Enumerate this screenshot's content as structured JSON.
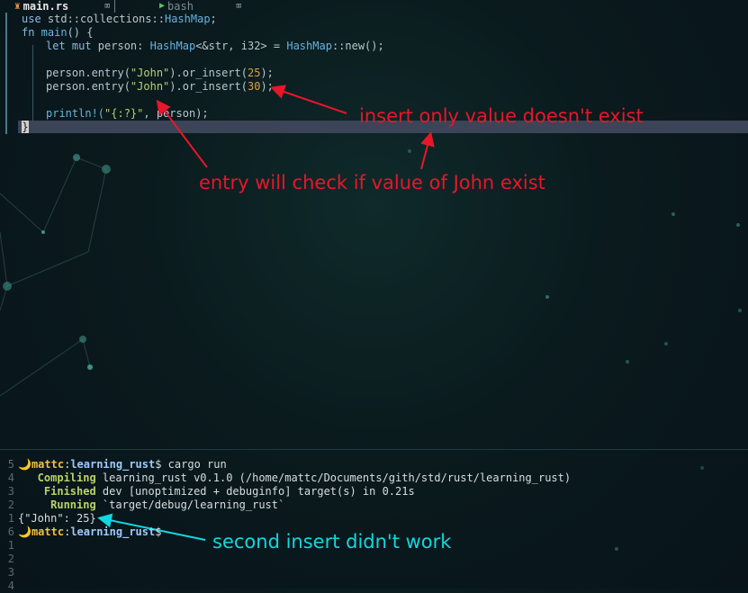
{
  "tabs": {
    "active": {
      "icon": "rust-file-icon",
      "label": "main.rs"
    },
    "second": {
      "icon": "terminal-icon",
      "label": "bash"
    },
    "close_glyph": "⌧"
  },
  "code": {
    "line1": {
      "kw": "use",
      "path": " std::collections::",
      "type": "HashMap",
      "end": ";"
    },
    "line2": {
      "kw": "fn",
      "name": " main",
      "rest": "() {"
    },
    "line3": {
      "kw": "let mut",
      "var": " person: ",
      "type1": "HashMap",
      "gen": "<&str, i32>",
      "eq": " = ",
      "type2": "HashMap",
      "call": "::new();"
    },
    "line4": {
      "pre": "person.entry(",
      "str": "\"John\"",
      "mid": ").or_insert(",
      "num": "25",
      "end": ");"
    },
    "line5": {
      "pre": "person.entry(",
      "str": "\"John\"",
      "mid": ").or_insert(",
      "num": "30",
      "end": ");"
    },
    "line6": {
      "pre": "println!(",
      "str": "\"{:?}\"",
      "end": ", person);"
    },
    "line7": "}"
  },
  "annotations": {
    "insert_note": "insert only value doesn't exist",
    "entry_note": "entry will check if value of John exist",
    "result_note": "second insert didn't work"
  },
  "terminal": {
    "prompt_user": "mattc",
    "prompt_colon": ":",
    "prompt_dir": "learning_rust",
    "prompt_symbol": "$",
    "moon": "🌙",
    "lines": [
      {
        "num": "5",
        "type": "prompt",
        "cmd": " cargo run"
      },
      {
        "num": "4",
        "type": "status",
        "status": "   Compiling",
        "text": " learning_rust v0.1.0 (/home/mattc/Documents/gith/std/rust/learning_rust)"
      },
      {
        "num": "3",
        "type": "status",
        "status": "    Finished",
        "text": " dev [unoptimized + debuginfo] target(s) in 0.21s"
      },
      {
        "num": "2",
        "type": "status",
        "status": "     Running",
        "text": " `target/debug/learning_rust`"
      },
      {
        "num": "1",
        "type": "out",
        "text": "{\"John\": 25}"
      },
      {
        "num": "6",
        "type": "prompt",
        "cmd": ""
      },
      {
        "num": "1",
        "type": "blank"
      },
      {
        "num": "2",
        "type": "blank"
      },
      {
        "num": "3",
        "type": "blank"
      },
      {
        "num": "4",
        "type": "blank"
      }
    ]
  },
  "colors": {
    "annotation_red": "#e8162a",
    "annotation_cyan": "#10d8e0"
  }
}
